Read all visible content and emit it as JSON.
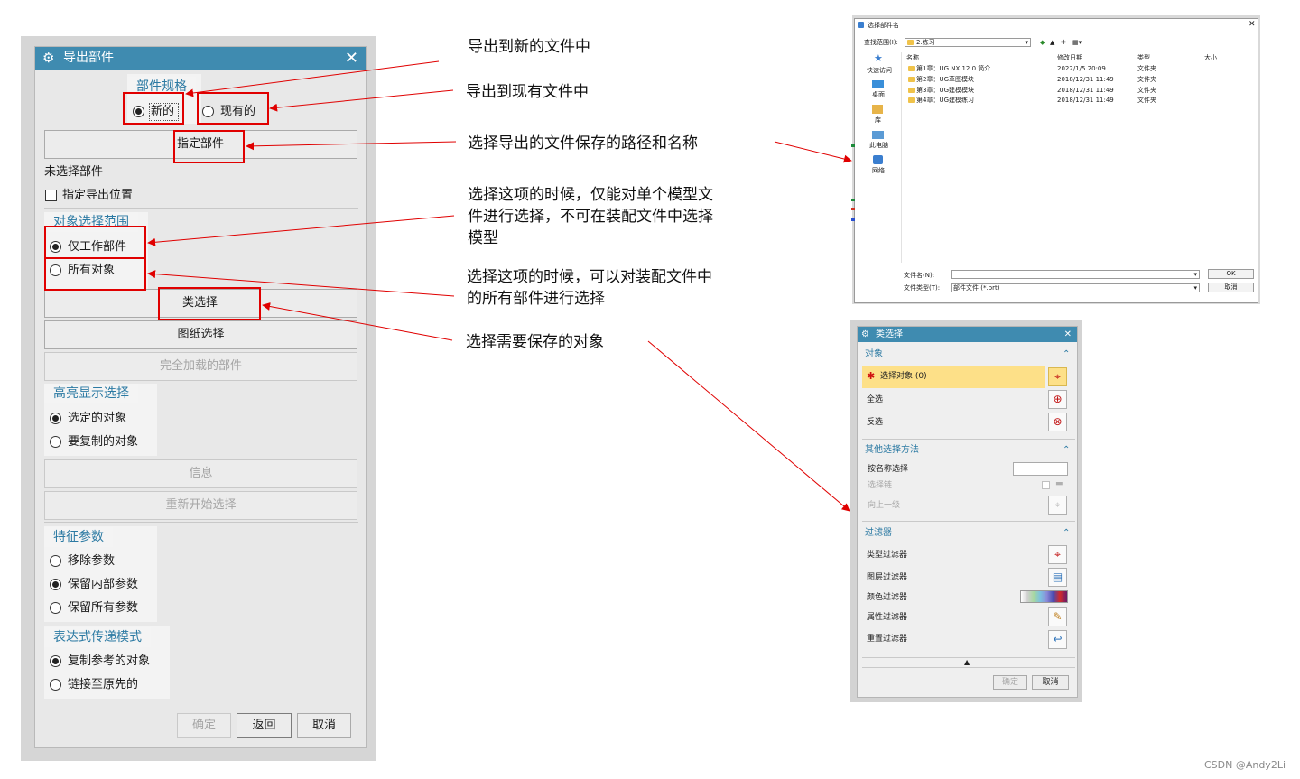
{
  "export_dialog": {
    "title": "导出部件",
    "part_spec": {
      "label": "部件规格",
      "options": [
        "新的",
        "现有的"
      ],
      "selected": "新的"
    },
    "specify_part_button": "指定部件",
    "no_part_selected": "未选择部件",
    "specify_export_location": "指定导出位置",
    "object_scope": {
      "label": "对象选择范围",
      "options": [
        "仅工作部件",
        "所有对象"
      ],
      "selected": "仅工作部件"
    },
    "class_select_button": "类选择",
    "drawing_select_button": "图纸选择",
    "fully_loaded_parts_button": "完全加载的部件",
    "highlight": {
      "label": "高亮显示选择",
      "options": [
        "选定的对象",
        "要复制的对象"
      ],
      "selected": "选定的对象"
    },
    "info_button": "信息",
    "restart_button": "重新开始选择",
    "feature_params": {
      "label": "特征参数",
      "options": [
        "移除参数",
        "保留内部参数",
        "保留所有参数"
      ],
      "selected": "保留内部参数"
    },
    "expression_mode": {
      "label": "表达式传递模式",
      "options": [
        "复制参考的对象",
        "链接至原先的"
      ],
      "selected": "复制参考的对象"
    },
    "footer": {
      "ok": "确定",
      "back": "返回",
      "cancel": "取消"
    }
  },
  "annotations": {
    "new_file": "导出到新的文件中",
    "existing_file": "导出到现有文件中",
    "save_path": "选择导出的文件保存的路径和名称",
    "work_part_only": [
      "选择这项的时候，仅能对单个模型文",
      "件进行选择，不可在装配文件中选择",
      "模型"
    ],
    "all_objects": [
      "选择这项的时候，可以对装配文件中",
      "的所有部件进行选择"
    ],
    "select_objects": "选择需要保存的对象"
  },
  "file_dialog": {
    "title": "选择部件名",
    "look_in_label": "查找范围(I):",
    "look_in_value": "2.练习",
    "nav": [
      "快速访问",
      "桌面",
      "库",
      "此电脑",
      "网络"
    ],
    "columns": [
      "名称",
      "修改日期",
      "类型",
      "大小"
    ],
    "rows": [
      {
        "name": "第1章：UG NX 12.0 简介",
        "date": "2022/1/5 20:09",
        "type": "文件夹"
      },
      {
        "name": "第2章：UG草图模块",
        "date": "2018/12/31 11:49",
        "type": "文件夹"
      },
      {
        "name": "第3章：UG建模模块",
        "date": "2018/12/31 11:49",
        "type": "文件夹"
      },
      {
        "name": "第4章：UG建模练习",
        "date": "2018/12/31 11:49",
        "type": "文件夹"
      }
    ],
    "filename_label": "文件名(N):",
    "filetype_label": "文件类型(T):",
    "filetype_value": "部件文件 (*.prt)",
    "ok": "OK",
    "cancel": "取消"
  },
  "class_dialog": {
    "title": "类选择",
    "object_section": "对象",
    "select_object": "选择对象 (0)",
    "select_all": "全选",
    "invert": "反选",
    "other_section": "其他选择方法",
    "by_name": "按名称选择",
    "select_chain": "选择链",
    "up_one_level": "向上一级",
    "filter_section": "过滤器",
    "filters": [
      "类型过滤器",
      "图层过滤器",
      "颜色过滤器",
      "属性过滤器",
      "重置过滤器"
    ],
    "ok": "确定",
    "cancel": "取消"
  },
  "watermark": "CSDN @Andy2Li"
}
